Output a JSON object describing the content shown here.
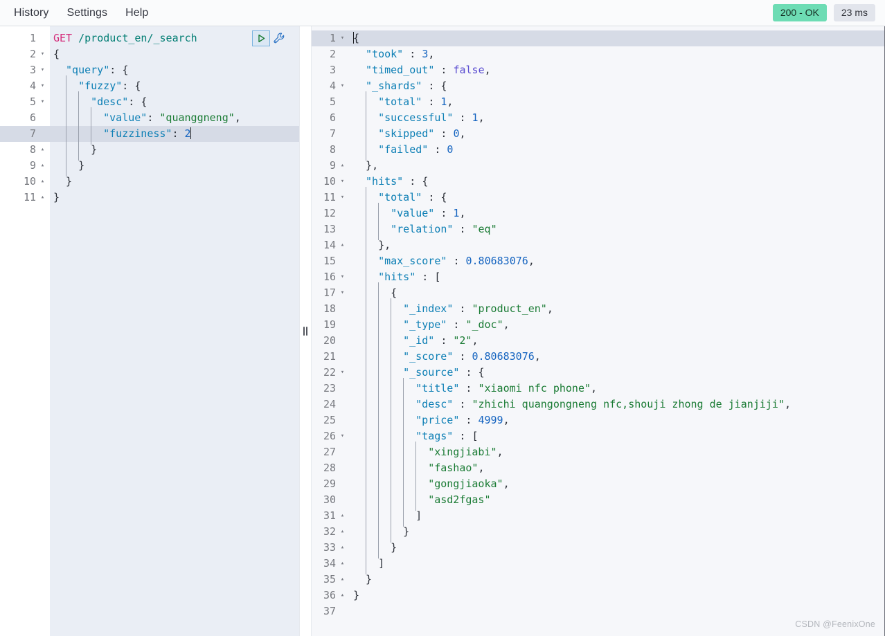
{
  "topbar": {
    "nav": [
      {
        "label": "History",
        "name": "history"
      },
      {
        "label": "Settings",
        "name": "settings"
      },
      {
        "label": "Help",
        "name": "help"
      }
    ],
    "status_badge": "200 - OK",
    "time_badge": "23 ms",
    "status_color": "#6ddcb4",
    "time_color": "#e2e5ec"
  },
  "request_editor": {
    "active_line": 7,
    "icons": {
      "run": "play-icon",
      "wrench": "wrench-icon"
    },
    "lines": [
      {
        "n": 1,
        "fold": "",
        "text": "GET /product_en/_search"
      },
      {
        "n": 2,
        "fold": "▾",
        "text": "{"
      },
      {
        "n": 3,
        "fold": "▾",
        "text": "  \"query\": {"
      },
      {
        "n": 4,
        "fold": "▾",
        "text": "    \"fuzzy\": {"
      },
      {
        "n": 5,
        "fold": "▾",
        "text": "      \"desc\": {"
      },
      {
        "n": 6,
        "fold": "",
        "text": "        \"value\": \"quanggneng\","
      },
      {
        "n": 7,
        "fold": "",
        "text": "        \"fuzziness\": 2"
      },
      {
        "n": 8,
        "fold": "▴",
        "text": "      }"
      },
      {
        "n": 9,
        "fold": "▴",
        "text": "    }"
      },
      {
        "n": 10,
        "fold": "▴",
        "text": "  }"
      },
      {
        "n": 11,
        "fold": "▴",
        "text": "}"
      }
    ]
  },
  "response_editor": {
    "active_line": 1,
    "lines": [
      {
        "n": 1,
        "fold": "▾",
        "text": "{"
      },
      {
        "n": 2,
        "fold": "",
        "text": "  \"took\" : 3,"
      },
      {
        "n": 3,
        "fold": "",
        "text": "  \"timed_out\" : false,"
      },
      {
        "n": 4,
        "fold": "▾",
        "text": "  \"_shards\" : {"
      },
      {
        "n": 5,
        "fold": "",
        "text": "    \"total\" : 1,"
      },
      {
        "n": 6,
        "fold": "",
        "text": "    \"successful\" : 1,"
      },
      {
        "n": 7,
        "fold": "",
        "text": "    \"skipped\" : 0,"
      },
      {
        "n": 8,
        "fold": "",
        "text": "    \"failed\" : 0"
      },
      {
        "n": 9,
        "fold": "▴",
        "text": "  },"
      },
      {
        "n": 10,
        "fold": "▾",
        "text": "  \"hits\" : {"
      },
      {
        "n": 11,
        "fold": "▾",
        "text": "    \"total\" : {"
      },
      {
        "n": 12,
        "fold": "",
        "text": "      \"value\" : 1,"
      },
      {
        "n": 13,
        "fold": "",
        "text": "      \"relation\" : \"eq\""
      },
      {
        "n": 14,
        "fold": "▴",
        "text": "    },"
      },
      {
        "n": 15,
        "fold": "",
        "text": "    \"max_score\" : 0.80683076,"
      },
      {
        "n": 16,
        "fold": "▾",
        "text": "    \"hits\" : ["
      },
      {
        "n": 17,
        "fold": "▾",
        "text": "      {"
      },
      {
        "n": 18,
        "fold": "",
        "text": "        \"_index\" : \"product_en\","
      },
      {
        "n": 19,
        "fold": "",
        "text": "        \"_type\" : \"_doc\","
      },
      {
        "n": 20,
        "fold": "",
        "text": "        \"_id\" : \"2\","
      },
      {
        "n": 21,
        "fold": "",
        "text": "        \"_score\" : 0.80683076,"
      },
      {
        "n": 22,
        "fold": "▾",
        "text": "        \"_source\" : {"
      },
      {
        "n": 23,
        "fold": "",
        "text": "          \"title\" : \"xiaomi nfc phone\","
      },
      {
        "n": 24,
        "fold": "",
        "text": "          \"desc\" : \"zhichi quangongneng nfc,shouji zhong de jianjiji\","
      },
      {
        "n": 25,
        "fold": "",
        "text": "          \"price\" : 4999,"
      },
      {
        "n": 26,
        "fold": "▾",
        "text": "          \"tags\" : ["
      },
      {
        "n": 27,
        "fold": "",
        "text": "            \"xingjiabi\","
      },
      {
        "n": 28,
        "fold": "",
        "text": "            \"fashao\","
      },
      {
        "n": 29,
        "fold": "",
        "text": "            \"gongjiaoka\","
      },
      {
        "n": 30,
        "fold": "",
        "text": "            \"asd2fgas\""
      },
      {
        "n": 31,
        "fold": "▴",
        "text": "          ]"
      },
      {
        "n": 32,
        "fold": "▴",
        "text": "        }"
      },
      {
        "n": 33,
        "fold": "▴",
        "text": "      }"
      },
      {
        "n": 34,
        "fold": "▴",
        "text": "    ]"
      },
      {
        "n": 35,
        "fold": "▴",
        "text": "  }"
      },
      {
        "n": 36,
        "fold": "▴",
        "text": "}"
      },
      {
        "n": 37,
        "fold": "",
        "text": ""
      }
    ]
  },
  "watermark": "CSDN @FeenixOne"
}
